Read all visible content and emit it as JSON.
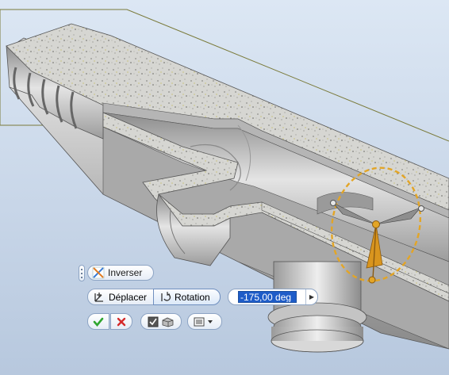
{
  "toolbar": {
    "inverser_label": "Inverser",
    "deplacer_label": "Déplacer",
    "rotation_label": "Rotation",
    "angle_value": "-175,00 deg"
  },
  "icons": {
    "inverser": "flip-direction-icon",
    "deplacer": "move-axes-icon",
    "rotation": "rotate-icon",
    "ok": "checkmark-icon",
    "cancel": "close-icon",
    "mode": "checkbox-solid-icon",
    "options": "list-menu-icon"
  },
  "colors": {
    "ok_green": "#2fa52f",
    "cancel_red": "#d42b2b",
    "gizmo_orange": "#e3a526",
    "field_highlight": "#1e5cc8"
  }
}
